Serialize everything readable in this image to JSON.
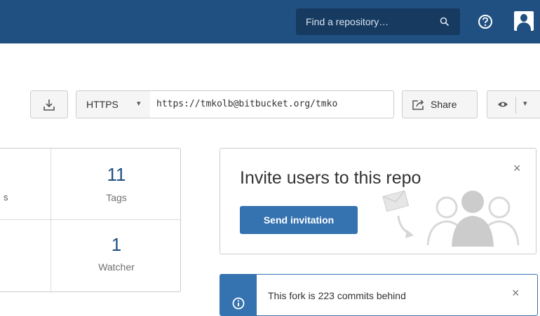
{
  "header": {
    "search_placeholder": "Find a repository…",
    "icons": [
      "search-icon",
      "help-icon",
      "user-avatar"
    ],
    "background_color": "#205081"
  },
  "clone": {
    "protocol_label": "HTTPS",
    "protocol_caret": "▾",
    "url_value": "https://tmkolb@bitbucket.org/tmko",
    "share_label": "Share",
    "watch_caret": "▾"
  },
  "stats": {
    "partial_label": "s",
    "tags_count": "11",
    "tags_label": "Tags",
    "watchers_count": "1",
    "watchers_label": "Watcher"
  },
  "invite": {
    "title": "Invite users to this repo",
    "close": "×",
    "button_label": "Send invitation",
    "button_color": "#3572b0"
  },
  "fork_notice": {
    "message": "This fork is 223 commits behind",
    "close": "×"
  }
}
